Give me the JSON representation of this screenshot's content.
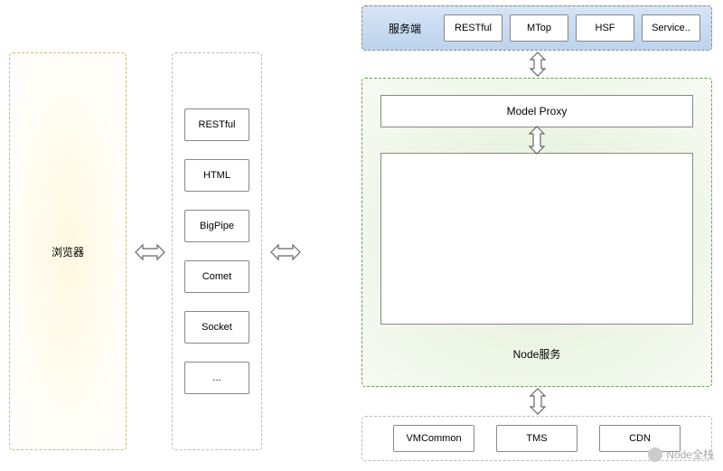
{
  "browser_label": "浏览器",
  "protocols": [
    "RESTful",
    "HTML",
    "BigPipe",
    "Comet",
    "Socket",
    "..."
  ],
  "server": {
    "label": "服务端",
    "items": [
      "RESTful",
      "MTop",
      "HSF",
      "Service.."
    ]
  },
  "node": {
    "model_proxy": "Model Proxy",
    "label": "Node服务"
  },
  "bottom": [
    "VMCommon",
    "TMS",
    "CDN"
  ],
  "watermark": "Node全栈"
}
